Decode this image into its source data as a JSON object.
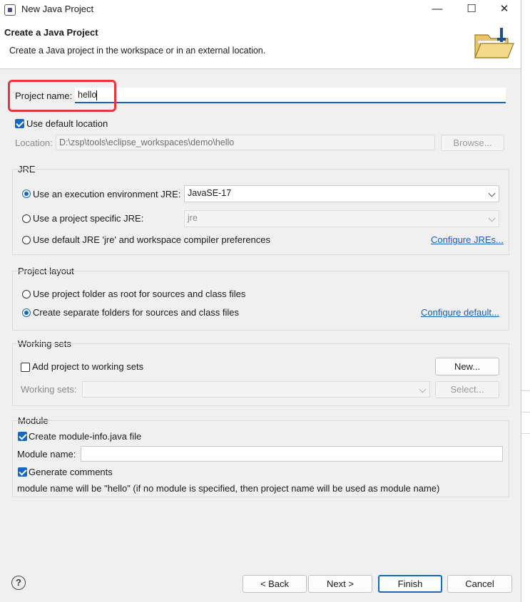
{
  "window": {
    "title": "New Java Project",
    "minimize_glyph": "—",
    "maximize_glyph": "☐",
    "close_glyph": "✕"
  },
  "banner": {
    "title": "Create a Java Project",
    "description": "Create a Java project in the workspace or in an external location."
  },
  "project": {
    "name_label": "Project name:",
    "name_value": "hello",
    "use_default_location_label": "Use default location",
    "use_default_location_checked": true,
    "location_label": "Location:",
    "location_value": "D:\\zsp\\tools\\eclipse_workspaces\\demo\\hello",
    "browse_label": "Browse..."
  },
  "jre": {
    "group_label": "JRE",
    "options": [
      {
        "label": "Use an execution environment JRE:",
        "selected": true
      },
      {
        "label": "Use a project specific JRE:",
        "selected": false
      },
      {
        "label": "Use default JRE 'jre' and workspace compiler preferences",
        "selected": false
      }
    ],
    "execution_env_value": "JavaSE-17",
    "project_specific_value": "jre",
    "configure_link": "Configure JREs..."
  },
  "layout": {
    "group_label": "Project layout",
    "options": [
      {
        "label": "Use project folder as root for sources and class files",
        "selected": false
      },
      {
        "label": "Create separate folders for sources and class files",
        "selected": true
      }
    ],
    "configure_link": "Configure default..."
  },
  "working_sets": {
    "group_label": "Working sets",
    "add_label": "Add project to working sets",
    "add_checked": false,
    "new_button": "New...",
    "sets_label": "Working sets:",
    "select_button": "Select..."
  },
  "module": {
    "group_label": "Module",
    "create_label": "Create module-info.java file",
    "create_checked": true,
    "name_label": "Module name:",
    "generate_label": "Generate comments",
    "generate_checked": true,
    "note": "module name will be \"hello\"  (if no module is specified, then project name will be used as module name)"
  },
  "footer": {
    "help": "?",
    "back": "< Back",
    "next": "Next >",
    "finish": "Finish",
    "cancel": "Cancel"
  },
  "colors": {
    "accent": "#1468c4",
    "highlight_box": "#e5383b",
    "link": "#1a5fb4"
  },
  "icons": {
    "window": "eclipse-icon",
    "banner": "folder-icon",
    "help": "help-icon"
  }
}
